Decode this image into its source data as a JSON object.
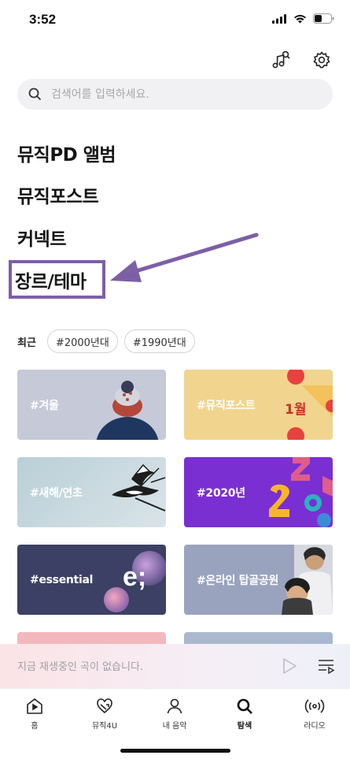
{
  "status_bar": {
    "time": "3:52"
  },
  "search": {
    "placeholder": "검색어를 입력하세요."
  },
  "menu": {
    "items": [
      "뮤직PD 앨범",
      "뮤직포스트",
      "커넥트",
      "장르/테마"
    ]
  },
  "recent": {
    "label": "최근",
    "tags": [
      "#2000년대",
      "#1990년대"
    ]
  },
  "genres": [
    {
      "label": "#겨울"
    },
    {
      "label": "#뮤직포스트",
      "badge": "1월"
    },
    {
      "label": "#새해/연초"
    },
    {
      "label": "#2020년"
    },
    {
      "label": "#essential",
      "mark": "e;"
    },
    {
      "label": "#온라인 탑골공원"
    }
  ],
  "player": {
    "status_text": "지금 재생중인 곡이 없습니다."
  },
  "tabs": [
    {
      "label": "홈",
      "icon": "home-icon"
    },
    {
      "label": "뮤직4U",
      "icon": "heart-shuffle-icon"
    },
    {
      "label": "내 음악",
      "icon": "person-icon"
    },
    {
      "label": "탐색",
      "icon": "search-icon",
      "active": true
    },
    {
      "label": "라디오",
      "icon": "radio-icon"
    }
  ],
  "colors": {
    "highlight_border": "#7d5fa6",
    "annotation_arrow": "#7d5fa6"
  }
}
